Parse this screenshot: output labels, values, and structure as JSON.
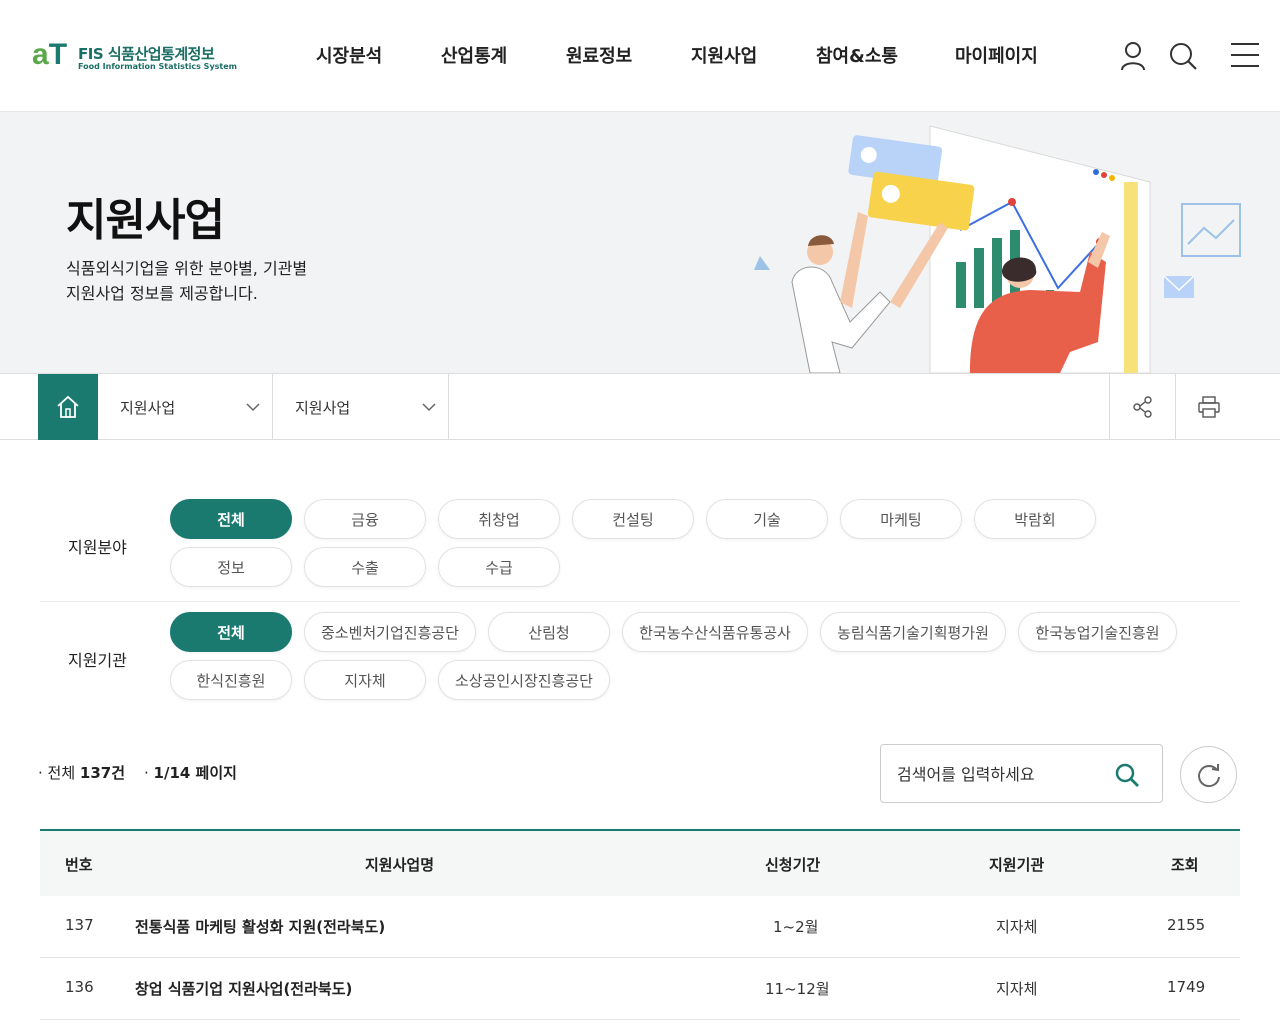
{
  "header": {
    "logo_name": "FIS 식품산업통계정보",
    "logo_sub": "Food Information Statistics System",
    "nav": [
      "시장분석",
      "산업통계",
      "원료정보",
      "지원사업",
      "참여&소통",
      "마이페이지"
    ]
  },
  "banner": {
    "title": "지원사업",
    "desc_line1": "식품외식기업을 위한 분야별, 기관별",
    "desc_line2": "지원사업 정보를 제공합니다."
  },
  "location": {
    "depth1": "지원사업",
    "depth2": "지원사업"
  },
  "filters": {
    "field_label": "지원분야",
    "field_chips": [
      "전체",
      "금융",
      "취창업",
      "컨설팅",
      "기술",
      "마케팅",
      "박람회",
      "정보",
      "수출",
      "수급"
    ],
    "agency_label": "지원기관",
    "agency_chips": [
      "전체",
      "중소벤처기업진흥공단",
      "산림청",
      "한국농수산식품유통공사",
      "농림식품기술기획평가원",
      "한국농업기술진흥원",
      "한식진흥원",
      "지자체",
      "소상공인시장진흥공단"
    ]
  },
  "list": {
    "total_prefix": "· 전체 ",
    "total_count": "137건",
    "page_prefix": "· ",
    "page_info": "1/14 페이지",
    "search_placeholder": "검색어를 입력하세요"
  },
  "table": {
    "headers": [
      "번호",
      "지원사업명",
      "신청기간",
      "지원기관",
      "조회"
    ],
    "rows": [
      {
        "no": "137",
        "title": "전통식품 마케팅 활성화 지원(전라북도)",
        "period": "1~2월",
        "agency": "지자체",
        "views": "2155"
      },
      {
        "no": "136",
        "title": "창업 식품기업 지원사업(전라북도)",
        "period": "11~12월",
        "agency": "지자체",
        "views": "1749"
      }
    ]
  },
  "colors": {
    "accent": "#1b7a70",
    "banner_bg": "#f2f3f4"
  }
}
